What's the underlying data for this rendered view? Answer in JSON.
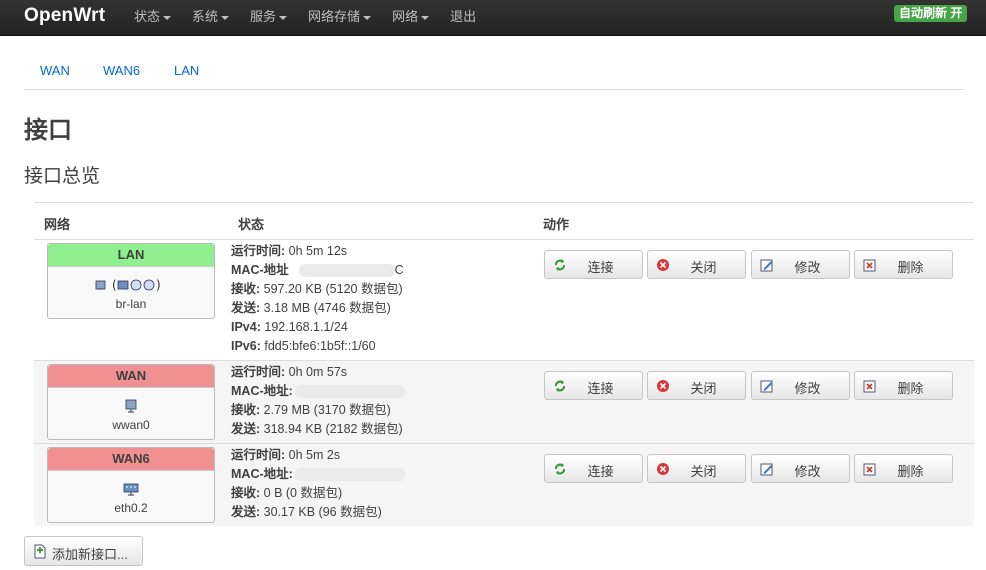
{
  "app": {
    "brand": "OpenWrt",
    "autorefresh": "自动刷新 开"
  },
  "menu": [
    "状态",
    "系统",
    "服务",
    "网络存储",
    "网络",
    "退出"
  ],
  "tabs": [
    "WAN",
    "WAN6",
    "LAN"
  ],
  "page_title": "接口",
  "section_title": "接口总览",
  "table": {
    "headers": {
      "network": "网络",
      "status": "状态",
      "actions": "动作"
    },
    "labels": {
      "uptime": "运行时间:",
      "mac": "MAC-地址",
      "mac_colon": "MAC-地址:",
      "rx": "接收:",
      "tx": "发送:",
      "ipv4": "IPv4:",
      "ipv6": "IPv6:"
    },
    "actions": {
      "connect": "连接",
      "stop": "关闭",
      "edit": "修改",
      "delete": "删除"
    },
    "rows": [
      {
        "name": "LAN",
        "header_color": "#90f090",
        "icons": "(  )",
        "device": "br-lan",
        "uptime": "0h 5m 12s",
        "mac_tail": "C",
        "rx": "597.20 KB (5120 数据包)",
        "tx": "3.18 MB (4746 数据包)",
        "ipv4": "192.168.1.1/24",
        "ipv6": "fdd5:bfe6:1b5f::1/60"
      },
      {
        "name": "WAN",
        "header_color": "#f09090",
        "device": "wwan0",
        "uptime": "0h 0m 57s",
        "rx": "2.79 MB (3170 数据包)",
        "tx": "318.94 KB (2182 数据包)"
      },
      {
        "name": "WAN6",
        "header_color": "#f09090",
        "device": "eth0.2",
        "uptime": "0h 5m 2s",
        "rx": "0 B (0 数据包)",
        "tx": "30.17 KB (96 数据包)"
      }
    ]
  },
  "add_button": "添加新接口...",
  "colors": {
    "topbar": "#222222",
    "accent_link": "#0069d6",
    "green": "#46a546"
  }
}
